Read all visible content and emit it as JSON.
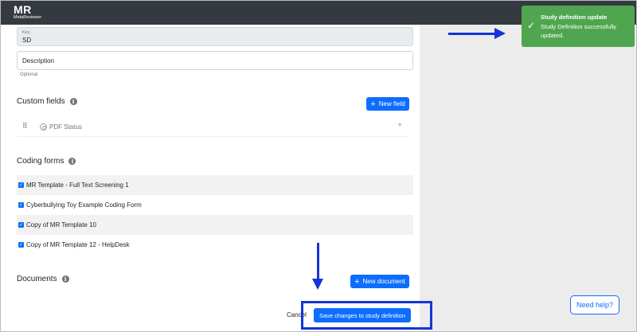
{
  "app": {
    "logo": "MR",
    "logo_subtitle": "MetaReviewer"
  },
  "key_field": {
    "label": "Key",
    "value": "SD"
  },
  "description_field": {
    "placeholder": "Description",
    "help": "Optional"
  },
  "custom_fields": {
    "title": "Custom fields",
    "new_button": "New field",
    "items": [
      {
        "name": "PDF Status"
      }
    ]
  },
  "coding_forms": {
    "title": "Coding forms",
    "items": [
      {
        "label": "MR Template - Full Text Screening 1",
        "checked": true
      },
      {
        "label": "Cyberbullying Toy Example Coding Form",
        "checked": true
      },
      {
        "label": "Copy of MR Template 10",
        "checked": true
      },
      {
        "label": "Copy of MR Template 12 - HelpDesk",
        "checked": true
      }
    ]
  },
  "documents": {
    "title": "Documents",
    "new_button": "New document"
  },
  "footer": {
    "cancel": "Cancel",
    "save": "Save changes to study definition"
  },
  "toast": {
    "title": "Study definition update",
    "body": "Study Definition successfully updated."
  },
  "help": {
    "label": "Need help?"
  },
  "colors": {
    "primary": "#0d6efd",
    "success_toast": "#4fa64f",
    "annotation": "#1534d6",
    "topbar": "#343a40"
  },
  "icons": {
    "info": "info-circle-icon",
    "plus": "plus-icon",
    "drag": "grip-icon",
    "check": "checkmark-icon"
  }
}
